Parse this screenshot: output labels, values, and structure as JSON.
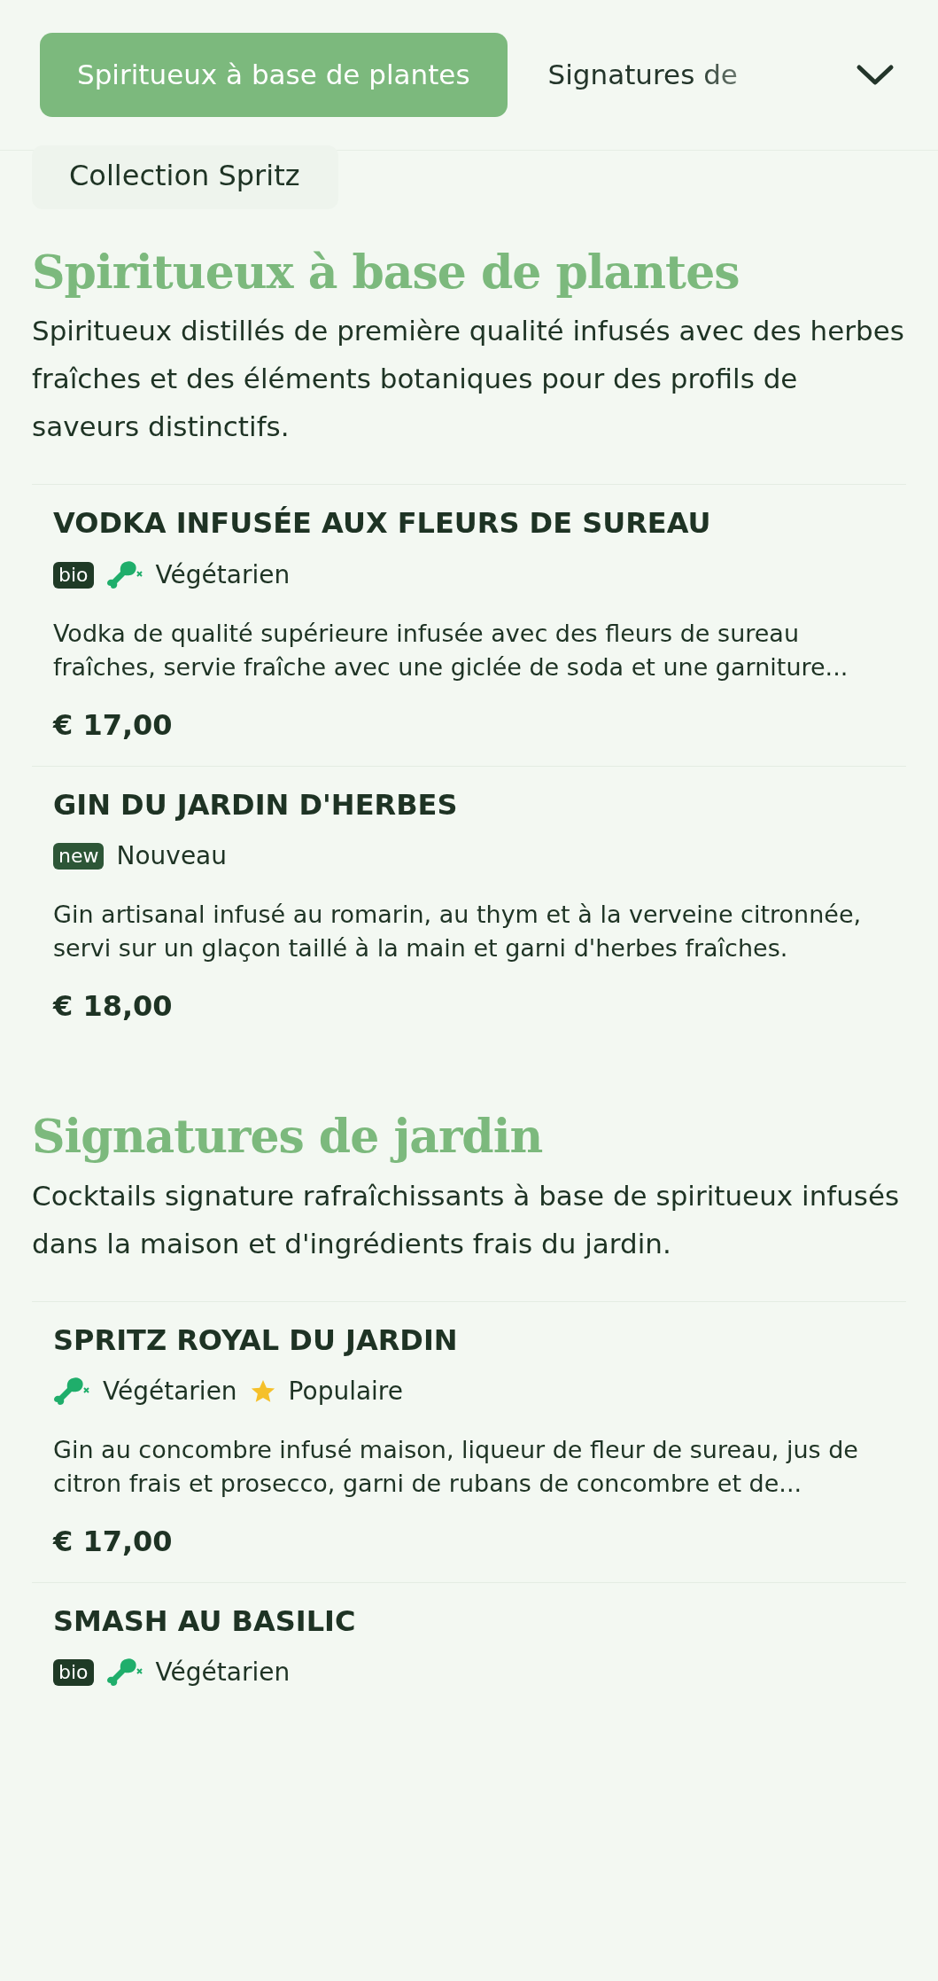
{
  "tabs": [
    {
      "label": "Spiritueux à base de plantes",
      "selected": true
    },
    {
      "label": "Signatures de",
      "selected": false
    }
  ],
  "subtabs": [
    {
      "label": "Collection Spritz",
      "selected": false
    }
  ],
  "sections": [
    {
      "title": "Spiritueux à base de plantes",
      "description": "Spiritueux distillés de première qualité infusés avec des herbes fraîches et des éléments botaniques pour des profils de saveurs distinctifs.",
      "items": [
        {
          "name": "VODKA INFUSÉE AUX FLEURS DE SUREAU",
          "tags": [
            {
              "kind": "badge",
              "label": "bio"
            },
            {
              "kind": "vegetarian",
              "label": "Végétarien"
            }
          ],
          "description": "Vodka de qualité supérieure infusée avec des fleurs de sureau fraîches, servie fraîche avec une giclée de soda et une garniture...",
          "price": "€ 17,00"
        },
        {
          "name": "GIN DU JARDIN D'HERBES",
          "tags": [
            {
              "kind": "new",
              "badge": "new",
              "label": "Nouveau"
            }
          ],
          "description": "Gin artisanal infusé au romarin, au thym et à la verveine citronnée, servi sur un glaçon taillé à la main et garni d'herbes fraîches.",
          "price": "€ 18,00"
        }
      ]
    },
    {
      "title": "Signatures de jardin",
      "description": "Cocktails signature rafraîchissants à base de spiritueux infusés dans la maison et d'ingrédients frais du jardin.",
      "items": [
        {
          "name": "SPRITZ ROYAL DU JARDIN",
          "tags": [
            {
              "kind": "vegetarian",
              "label": "Végétarien"
            },
            {
              "kind": "popular",
              "label": "Populaire"
            }
          ],
          "description": "Gin au concombre infusé maison, liqueur de fleur de sureau, jus de citron frais et prosecco, garni de rubans de concombre et de...",
          "price": "€ 17,00"
        },
        {
          "name": "SMASH AU BASILIC",
          "tags": [
            {
              "kind": "badge",
              "label": "bio"
            },
            {
              "kind": "vegetarian",
              "label": "Végétarien"
            }
          ]
        }
      ]
    }
  ]
}
